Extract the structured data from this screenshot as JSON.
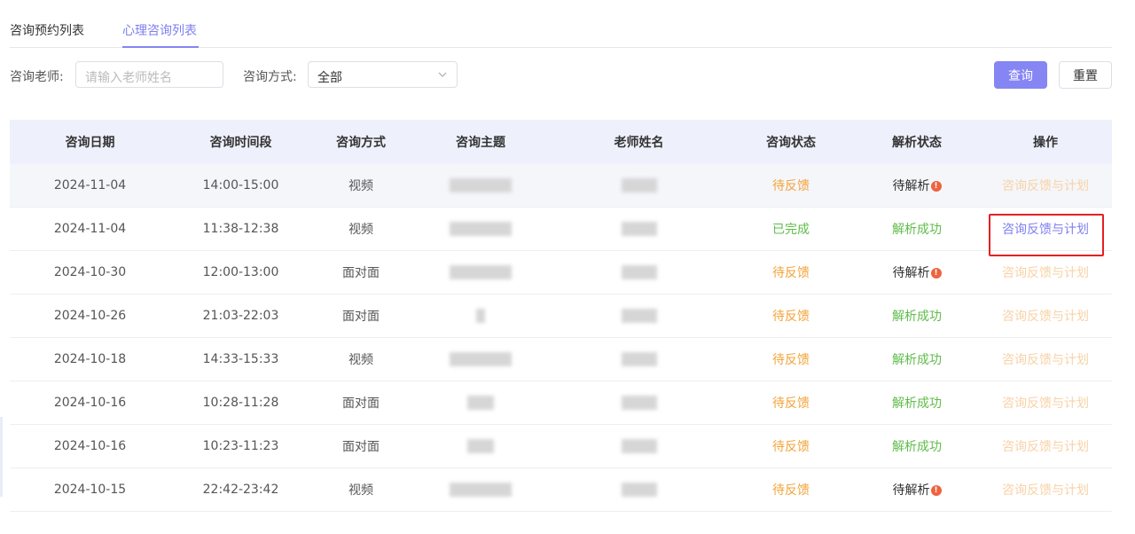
{
  "tabs": [
    {
      "label": "咨询预约列表",
      "active": false
    },
    {
      "label": "心理咨询列表",
      "active": true
    }
  ],
  "filters": {
    "teacher_label": "咨询老师:",
    "teacher_placeholder": "请输入老师姓名",
    "method_label": "咨询方式:",
    "method_value": "全部"
  },
  "buttons": {
    "query": "查询",
    "reset": "重置"
  },
  "table": {
    "headers": [
      "咨询日期",
      "咨询时间段",
      "咨询方式",
      "咨询主题",
      "老师姓名",
      "咨询状态",
      "解析状态",
      "操作"
    ],
    "action_label": "咨询反馈与计划",
    "rows": [
      {
        "date": "2024-11-04",
        "time": "14:00-15:00",
        "method": "视频",
        "status": "待反馈",
        "status_color": "#f3a338",
        "parse": "待解析",
        "parse_ok": false,
        "action_active": false
      },
      {
        "date": "2024-11-04",
        "time": "11:38-12:38",
        "method": "视频",
        "status": "已完成",
        "status_color": "#5fbc4a",
        "parse": "解析成功",
        "parse_ok": true,
        "action_active": true
      },
      {
        "date": "2024-10-30",
        "time": "12:00-13:00",
        "method": "面对面",
        "status": "待反馈",
        "status_color": "#f3a338",
        "parse": "待解析",
        "parse_ok": false,
        "action_active": false
      },
      {
        "date": "2024-10-26",
        "time": "21:03-22:03",
        "method": "面对面",
        "status": "待反馈",
        "status_color": "#f3a338",
        "parse": "解析成功",
        "parse_ok": true,
        "action_active": false
      },
      {
        "date": "2024-10-18",
        "time": "14:33-15:33",
        "method": "视频",
        "status": "待反馈",
        "status_color": "#f3a338",
        "parse": "解析成功",
        "parse_ok": true,
        "action_active": false
      },
      {
        "date": "2024-10-16",
        "time": "10:28-11:28",
        "method": "面对面",
        "status": "待反馈",
        "status_color": "#f3a338",
        "parse": "解析成功",
        "parse_ok": true,
        "action_active": false
      },
      {
        "date": "2024-10-16",
        "time": "10:23-11:23",
        "method": "面对面",
        "status": "待反馈",
        "status_color": "#f3a338",
        "parse": "解析成功",
        "parse_ok": true,
        "action_active": false
      },
      {
        "date": "2024-10-15",
        "time": "22:42-23:42",
        "method": "视频",
        "status": "待反馈",
        "status_color": "#f3a338",
        "parse": "待解析",
        "parse_ok": false,
        "action_active": false
      }
    ]
  },
  "icons": {
    "select_arrow": "chevron-down-icon",
    "parse_alert": "exclamation-alert-icon"
  },
  "colors": {
    "accent": "#8585f3",
    "pending": "#f3a338",
    "success": "#5fbc4a",
    "alert": "#ed6440",
    "highlight": "#e52020"
  }
}
